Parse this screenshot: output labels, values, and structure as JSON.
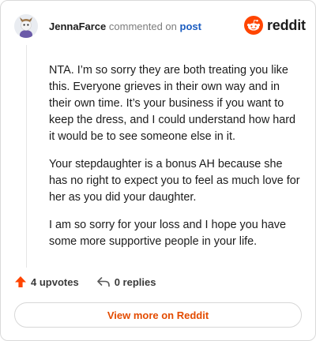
{
  "header": {
    "username": "JennaFarce",
    "action_text": "commented on",
    "post_link": "post"
  },
  "logo": {
    "wordmark": "reddit",
    "icon": "reddit-snoo-icon",
    "color": "#ff4500"
  },
  "comment": {
    "paragraphs": [
      "NTA. I’m so sorry they are both treating you like this. Everyone grieves in their own way and in their own time. It’s your business if you want to keep the dress, and I could understand how hard it would be to see someone else in it.",
      "Your stepdaughter is a bonus AH because she has no right to expect you to feel as much love for her as you did your daughter.",
      "I am so sorry for your loss and I hope you have some more supportive people in your life."
    ]
  },
  "actions": {
    "upvotes_label": "4 upvotes",
    "upvote_icon": "upvote-arrow-icon",
    "upvote_color": "#ff4500",
    "replies_label": "0 replies",
    "reply_icon": "reply-arrow-icon"
  },
  "footer": {
    "view_more_label": "View more on Reddit",
    "accent": "#e34b00"
  }
}
